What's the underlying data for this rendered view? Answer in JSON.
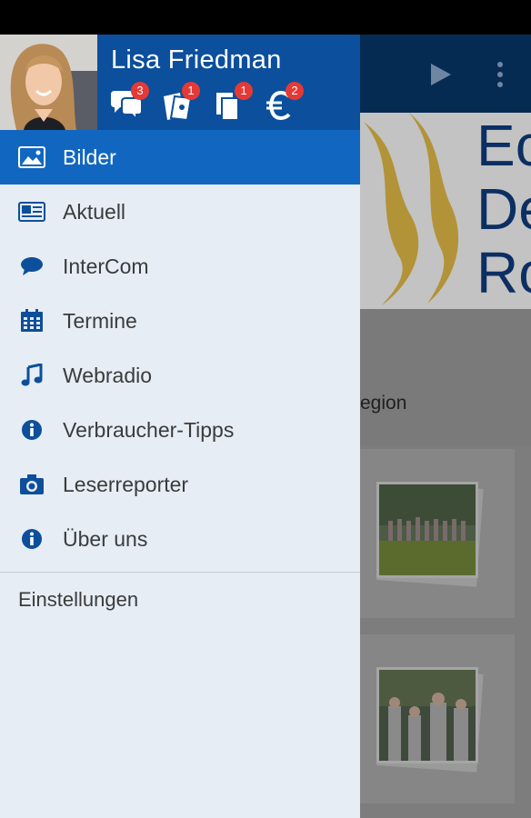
{
  "user": {
    "name": "Lisa Friedman",
    "badges": {
      "messages": "3",
      "tickets": "1",
      "documents": "1",
      "euro": "2"
    }
  },
  "menu": {
    "items": [
      {
        "label": "Bilder",
        "icon": "image-icon",
        "active": true
      },
      {
        "label": "Aktuell",
        "icon": "newspaper-icon",
        "active": false
      },
      {
        "label": "InterCom",
        "icon": "chat-bubble-icon",
        "active": false
      },
      {
        "label": "Termine",
        "icon": "calendar-icon",
        "active": false
      },
      {
        "label": "Webradio",
        "icon": "music-note-icon",
        "active": false
      },
      {
        "label": "Verbraucher-Tipps",
        "icon": "info-icon",
        "active": false
      },
      {
        "label": "Leserreporter",
        "icon": "camera-icon",
        "active": false
      },
      {
        "label": "Über uns",
        "icon": "info-icon",
        "active": false
      }
    ],
    "settings_label": "Einstellungen"
  },
  "background": {
    "banner_letters": [
      "Ec",
      "De",
      "Ro"
    ],
    "region_text": "egion"
  },
  "colors": {
    "header_blue": "#0b4f9d",
    "active_item": "#1167c0",
    "drawer_bg": "#e6edf5",
    "badge_red": "#e53935",
    "icon_blue": "#0d4f9a"
  }
}
